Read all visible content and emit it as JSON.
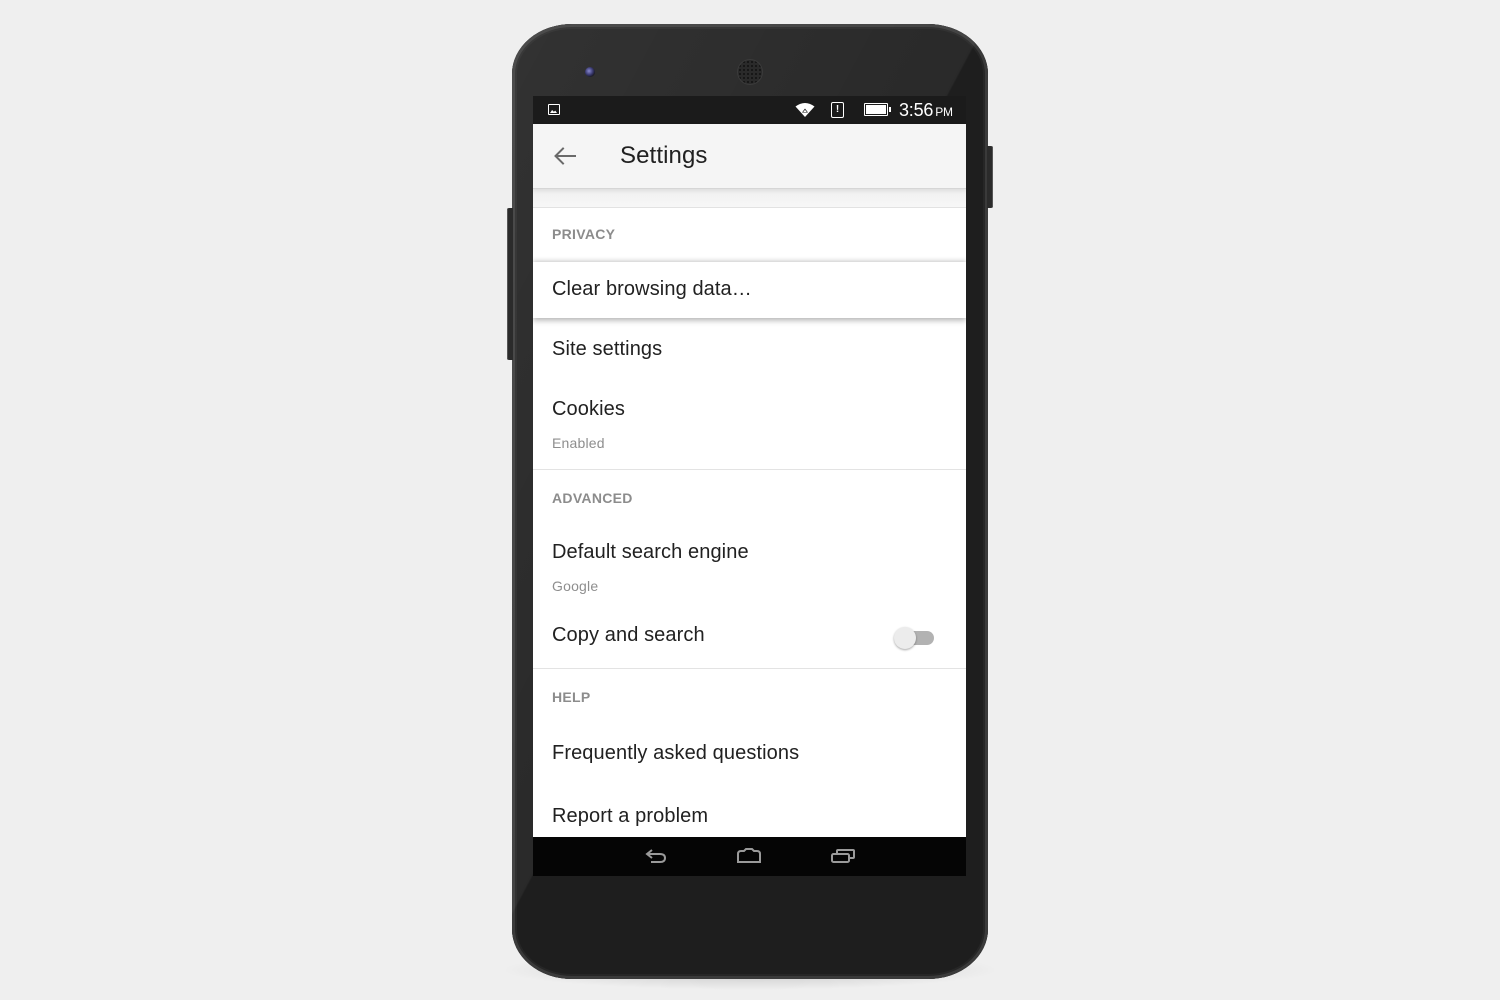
{
  "status_bar": {
    "notification_icon": "image-icon",
    "wifi_icon": "wifi-icon",
    "alert_icon": "sim-alert-icon",
    "alert_glyph": "!",
    "battery_icon": "battery-full-icon",
    "time": "3:56",
    "ampm": "PM"
  },
  "app_bar": {
    "back_icon": "arrow-left-icon",
    "title": "Settings"
  },
  "sections": [
    {
      "header": "PRIVACY",
      "items": [
        {
          "title": "Clear browsing data…"
        },
        {
          "title": "Site settings"
        },
        {
          "title": "Cookies",
          "subtitle": "Enabled"
        }
      ]
    },
    {
      "header": "ADVANCED",
      "items": [
        {
          "title": "Default search engine",
          "subtitle": "Google"
        },
        {
          "title": "Copy and search",
          "toggle": false
        }
      ]
    },
    {
      "header": "HELP",
      "items": [
        {
          "title": "Frequently asked questions"
        },
        {
          "title": "Report a problem"
        }
      ]
    }
  ],
  "nav_bar": {
    "back_icon": "nav-back-icon",
    "home_icon": "nav-home-icon",
    "recents_icon": "nav-recents-icon"
  },
  "colors": {
    "background": "#efefef",
    "phone_body": "#1e1e1e",
    "status_bar": "#1b1b1b",
    "app_bar": "#f5f5f5",
    "primary_text": "#212121",
    "secondary_text": "#8e8e8e",
    "section_header": "#8c8c8c",
    "toggle_track_off": "#b2b2b2",
    "toggle_thumb_off": "#ececec"
  }
}
